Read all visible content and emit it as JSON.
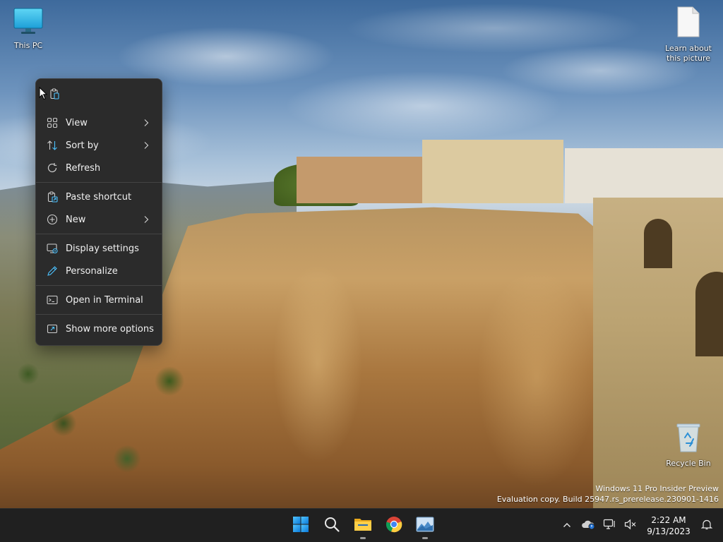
{
  "desktop": {
    "icons": [
      {
        "label": "This PC",
        "icon": "monitor-icon"
      },
      {
        "label": "Learn about this picture",
        "icon": "document-icon"
      },
      {
        "label": "Recycle Bin",
        "icon": "recycle-bin-icon"
      }
    ],
    "watermark": {
      "line1": "Windows 11 Pro Insider Preview",
      "line2": "Evaluation copy. Build 25947.rs_prerelease.230901-1416"
    }
  },
  "context_menu": {
    "quick_actions": [
      {
        "icon": "paste-icon"
      }
    ],
    "items": [
      {
        "label": "View",
        "icon": "grid-icon",
        "submenu": true
      },
      {
        "label": "Sort by",
        "icon": "sort-icon",
        "submenu": true
      },
      {
        "label": "Refresh",
        "icon": "refresh-icon",
        "submenu": false
      },
      {
        "label": "Paste shortcut",
        "icon": "paste-shortcut-icon",
        "submenu": false
      },
      {
        "label": "New",
        "icon": "plus-circle-icon",
        "submenu": true
      },
      {
        "label": "Display settings",
        "icon": "display-settings-icon",
        "submenu": false
      },
      {
        "label": "Personalize",
        "icon": "pen-icon",
        "submenu": false
      },
      {
        "label": "Open in Terminal",
        "icon": "terminal-icon",
        "submenu": false
      },
      {
        "label": "Show more options",
        "icon": "show-more-icon",
        "submenu": false
      }
    ]
  },
  "taskbar": {
    "apps": [
      {
        "name": "start",
        "icon": "windows-logo-icon"
      },
      {
        "name": "search",
        "icon": "search-icon"
      },
      {
        "name": "file-explorer",
        "icon": "folder-icon"
      },
      {
        "name": "chrome",
        "icon": "chrome-icon"
      },
      {
        "name": "photos",
        "icon": "photos-icon"
      }
    ],
    "tray": {
      "time": "2:22 AM",
      "date": "9/13/2023"
    }
  },
  "colors": {
    "menu_bg": "#2b2b2b",
    "taskbar_bg": "#202020",
    "accent_blue": "#0078d4",
    "accent_cyan": "#4cc2ff"
  }
}
